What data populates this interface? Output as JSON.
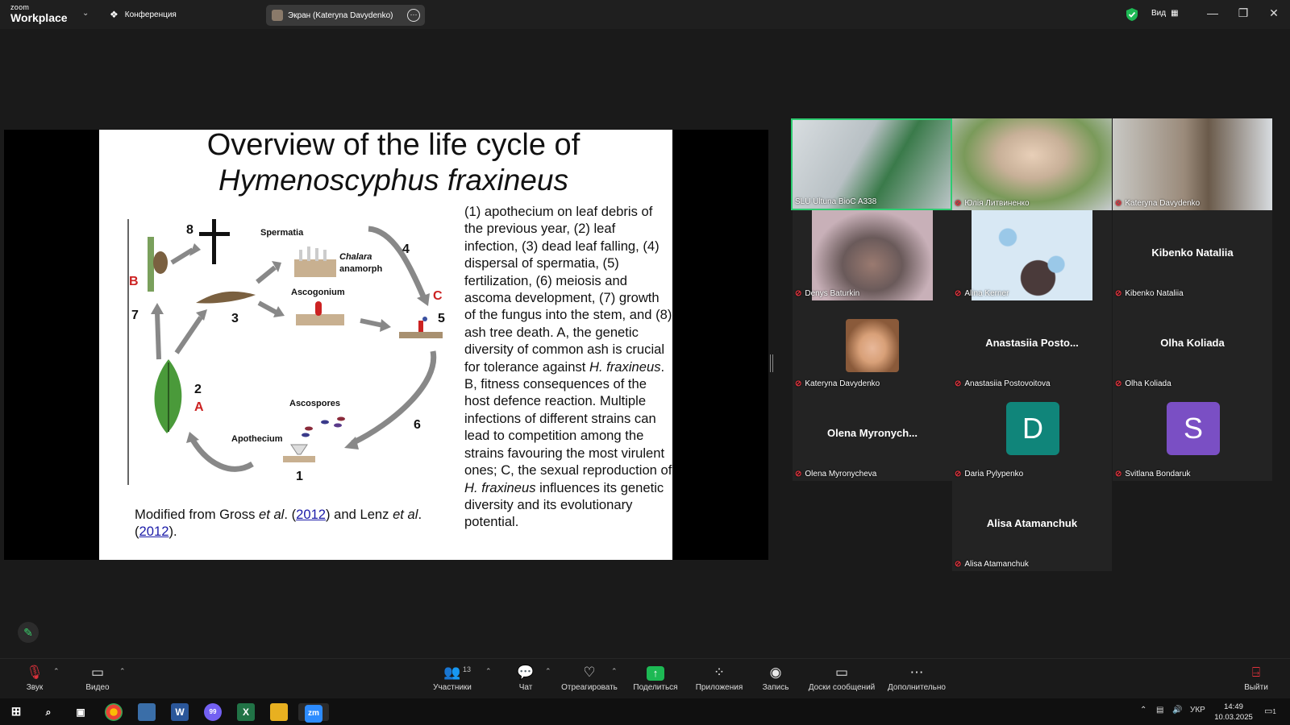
{
  "titlebar": {
    "brand_line1": "zoom",
    "brand_line2": "Workplace",
    "meeting_label": "Конференция",
    "share_label": "Экран (Kateryna Davydenko)",
    "view_label": "Вид"
  },
  "slide": {
    "title_line1": "Overview of the life cycle of",
    "title_line2": "Hymenoscyphus fraxineus",
    "caption_parts": [
      "(1) apothecium on leaf debris of the previous year, (2) leaf infection, (3) dead leaf falling, (4) dispersal of spermatia, (5) fertilization, (6) meiosis and ascoma development, (7) growth of the fungus into the stem, and (8) ash tree death. A, the genetic diversity of common ash is crucial for tolerance against ",
      "H. fraxineus",
      ". B, fitness consequences of the host defence reaction. Multiple infections of different strains can lead to competition among the strains favouring the most virulent ones; C, the sexual reproduction of ",
      "H. fraxineus",
      " influences its genetic diversity and its evolutionary potential."
    ],
    "credit_parts": [
      "Modified from Gross ",
      "et al",
      ". (",
      "2012",
      ") and Lenz ",
      "et al",
      ". (",
      "2012",
      ")."
    ],
    "diagram_labels": {
      "spermatia": "Spermatia",
      "chalara": "Chalara",
      "anamorph": "anamorph",
      "ascogonium": "Ascogonium",
      "ascospores": "Ascospores",
      "apothecium": "Apothecium",
      "n1": "1",
      "n2": "2",
      "n3": "3",
      "n4": "4",
      "n5": "5",
      "n6": "6",
      "n7": "7",
      "n8": "8",
      "A": "A",
      "B": "B",
      "C": "C"
    }
  },
  "participants": [
    {
      "name": "SLU Ultuna BioC A338",
      "kind": "video",
      "muted": false,
      "active": true
    },
    {
      "name": "Юлія Литвиненко",
      "kind": "video",
      "muted": true
    },
    {
      "name": "Kateryna Davydenko",
      "kind": "video",
      "muted": true
    },
    {
      "name": "Denys Baturkin",
      "kind": "video",
      "muted": true
    },
    {
      "name": "Alina Kerner",
      "kind": "video",
      "muted": true
    },
    {
      "name": "Kibenko Nataliia",
      "kind": "name",
      "display": "Kibenko Nataliia",
      "muted": true
    },
    {
      "name": "Kateryna Davydenko",
      "kind": "photo",
      "muted": true
    },
    {
      "name": "Anastasiia Postovoitova",
      "kind": "name",
      "display": "Anastasiia  Posto...",
      "muted": true
    },
    {
      "name": "Olha Koliada",
      "kind": "name",
      "display": "Olha Koliada",
      "muted": true
    },
    {
      "name": "Olena Myronycheva",
      "kind": "name",
      "display": "Olena  Myronych...",
      "muted": true
    },
    {
      "name": "Daria Pylypenko",
      "kind": "letter",
      "letter": "D",
      "color": "#10857a",
      "muted": true
    },
    {
      "name": "Svitlana Bondaruk",
      "kind": "letter",
      "letter": "S",
      "color": "#7a4fc4",
      "muted": true
    },
    {
      "name": "Alisa Atamanchuk",
      "kind": "name",
      "display": "Alisa Atamanchuk",
      "muted": true
    }
  ],
  "toolbar": {
    "audio": "Звук",
    "video": "Видео",
    "participants": "Участники",
    "participants_count": "13",
    "chat": "Чат",
    "react": "Отреагировать",
    "share": "Поделиться",
    "apps": "Приложения",
    "record": "Запись",
    "whiteboards": "Доски сообщений",
    "more": "Дополнительно",
    "leave": "Выйти"
  },
  "taskbar": {
    "language": "УКР",
    "time": "14:49",
    "date": "10.03.2025",
    "notification_count": "1",
    "viber_badge": "99"
  },
  "colors": {
    "accent_green": "#2ecc71",
    "share_green": "#1db954",
    "muted_red": "#e0323c",
    "letter_d": "#10857a",
    "letter_s": "#7a4fc4"
  }
}
